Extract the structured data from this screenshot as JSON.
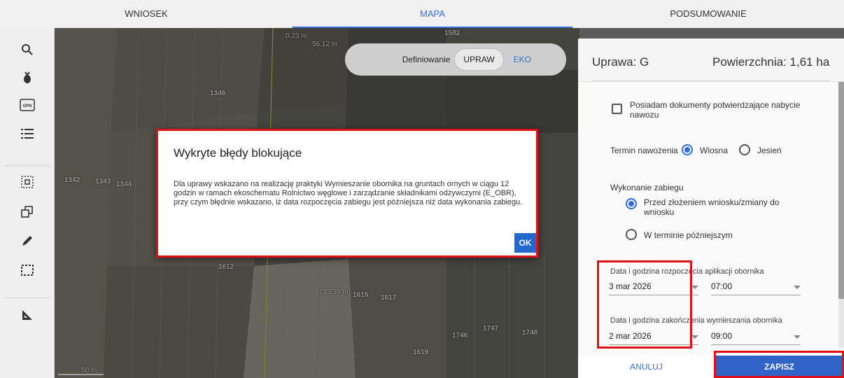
{
  "tabs": [
    {
      "label": "WNIOSEK"
    },
    {
      "label": "MAPA"
    },
    {
      "label": "PODSUMOWANIE"
    }
  ],
  "toolbar": {
    "items": [
      "search-icon",
      "crop-icon",
      "opn-icon",
      "list-icon",
      "select-area-icon",
      "copy-shape-icon",
      "pencil-icon",
      "dashed-rect-icon",
      "measure-icon"
    ],
    "opn_label": "OPN"
  },
  "map": {
    "definiowanie_label": "Definiowanie",
    "upraw_label": "UPRAW",
    "eko_label": "EKO",
    "labels": [
      "1582",
      "1346",
      "1342",
      "1343",
      "1344",
      "1612",
      "1616",
      "1617",
      "1746",
      "1747",
      "1748",
      "1619"
    ],
    "measure_labels": [
      "0.23 m",
      "56.12 m",
      "143.39 m",
      "50 m"
    ]
  },
  "dialog": {
    "title": "Wykryte błędy blokujące",
    "body": "Dla uprawy wskazano na realizację praktyki Wymieszanie obornika na gruntach ornych w ciągu 12 godzin w ramach ekoschematu Rolnictwo węglowe i zarządzanie składnikami odżywczymi (E_OBR), przy czym błędnie wskazano, iż data rozpoczęcia zabiegu jest późniejsza niż data wykonania zabiegu.",
    "ok_label": "OK"
  },
  "panel": {
    "crop_label": "Uprawa: G",
    "area_label": "Powierzchnia: 1,61 ha",
    "checkbox_text": "Posiadam dokumenty potwierdzające nabycie nawozu",
    "termin_label": "Termin nawożenia",
    "termin_opt1": "Wiosna",
    "termin_opt2": "Jesień",
    "wykonanie_label": "Wykonanie zabiegu",
    "wykonanie_opt1": "Przed złożeniem wniosku/zmiany do wniosku",
    "wykonanie_opt2": "W terminie późniejszym",
    "start_label": "Data i godzina rozpoczęcia aplikacji obornika",
    "start_date": "3 mar 2026",
    "start_time": "07:00",
    "end_label": "Data i godzina zakończenia wymieszania obornika",
    "end_date": "2 mar 2026",
    "end_time": "09:00",
    "cancel_label": "ANULUJ",
    "save_label": "ZAPISZ"
  },
  "colors": {
    "accent": "#2e6fd8",
    "error_outline": "#e0101a",
    "save_button": "#2f63c6"
  }
}
